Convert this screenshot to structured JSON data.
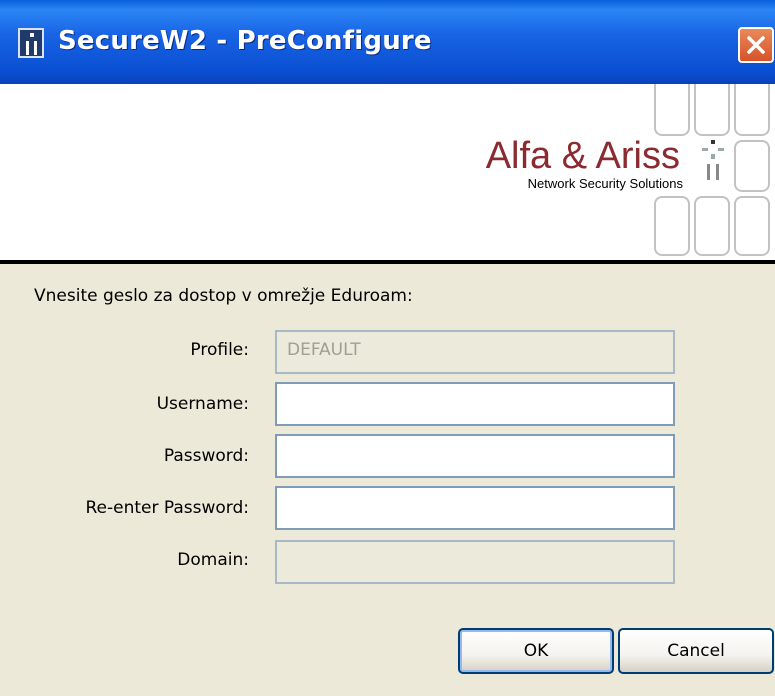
{
  "window": {
    "title": "SecureW2 - PreConfigure"
  },
  "banner": {
    "company": "Alfa & Ariss",
    "tagline": "Network Security Solutions"
  },
  "form": {
    "prompt": "Vnesite geslo za dostop v omrežje Eduroam:",
    "profile_label": "Profile:",
    "profile_value": "DEFAULT",
    "username_label": "Username:",
    "username_value": "",
    "password_label": "Password:",
    "password_value": "",
    "reenter_label": "Re-enter Password:",
    "reenter_value": "",
    "domain_label": "Domain:",
    "domain_value": ""
  },
  "buttons": {
    "ok": "OK",
    "cancel": "Cancel"
  },
  "icons": {
    "app": "app-icon",
    "close": "close-icon",
    "logo": "alfa-ariss-logo-icon"
  },
  "colors": {
    "titlebar": "#0a4fd2",
    "brand": "#8b2a30",
    "close": "#d6532a",
    "dialog_bg": "#ece9d8"
  }
}
